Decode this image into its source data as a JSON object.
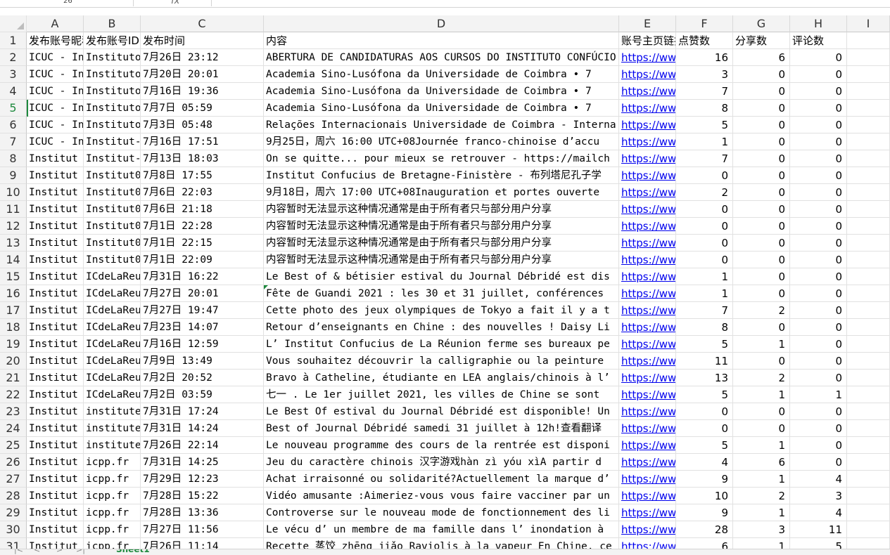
{
  "formula_bar": {
    "cell_ref": "26",
    "fx": "fx"
  },
  "columns": [
    "A",
    "B",
    "C",
    "D",
    "E",
    "F",
    "G",
    "H",
    "I"
  ],
  "sheet_tab": "Sheet1",
  "header_row": [
    "发布账号昵称",
    "发布账号ID",
    "发布时间",
    "内容",
    "账号主页链接",
    "点赞数",
    "分享数",
    "评论数",
    ""
  ],
  "rows": [
    [
      "ICUC - Instituto",
      "Instituto",
      "7月26日 23:12",
      "ABERTURA DE CANDIDATURAS AOS CURSOS DO INSTITUTO CONFÚCIO",
      "https://www",
      "16",
      "6",
      "0",
      ""
    ],
    [
      "ICUC - Instituto",
      "Instituto",
      "7月20日 20:01",
      "Academia Sino-Lusófona da Universidade de Coimbra  •  7",
      "https://www",
      "3",
      "0",
      "0",
      ""
    ],
    [
      "ICUC - Instituto",
      "Instituto",
      "7月16日 19:36",
      "Academia Sino-Lusófona da Universidade de Coimbra  •  7",
      "https://www",
      "7",
      "0",
      "0",
      ""
    ],
    [
      "ICUC - Instituto",
      "Instituto",
      "7月7日 05:59",
      "Academia Sino-Lusófona da Universidade de Coimbra  •  7",
      "https://www",
      "8",
      "0",
      "0",
      ""
    ],
    [
      "ICUC - Instituto",
      "Instituto",
      "7月3日 05:48",
      "Relações Internacionais Universidade de Coimbra - Interna",
      "https://www",
      "5",
      "0",
      "0",
      ""
    ],
    [
      "ICUC - Instituto",
      "Institut-",
      "7月16日 17:51",
      "9月25日，周六 16:00 UTC+08Journée franco-chinoise d’accu",
      "https://www",
      "1",
      "0",
      "0",
      ""
    ],
    [
      "Institut",
      "Institut-",
      "7月13日 18:03",
      "On se quitte... pour mieux se retrouver - https://mailch",
      "https://www",
      "7",
      "0",
      "0",
      ""
    ],
    [
      "Institut",
      "Institut0",
      "7月8日 17:55",
      "Institut Confucius de Bretagne-Finistère - 布列塔尼孔子学",
      "https://www",
      "0",
      "0",
      "0",
      ""
    ],
    [
      "Institut",
      "Institut0",
      "7月6日 22:03",
      "9月18日，周六 17:00 UTC+08Inauguration et portes ouverte",
      "https://www",
      "2",
      "0",
      "0",
      ""
    ],
    [
      "Institut",
      "Institut0",
      "7月6日 21:18",
      "内容暂时无法显示这种情况通常是由于所有者只与部分用户分享",
      "https://www",
      "0",
      "0",
      "0",
      ""
    ],
    [
      "Institut",
      "Institut0",
      "7月1日 22:28",
      "内容暂时无法显示这种情况通常是由于所有者只与部分用户分享",
      "https://www",
      "0",
      "0",
      "0",
      ""
    ],
    [
      "Institut",
      "Institut0",
      "7月1日 22:15",
      "内容暂时无法显示这种情况通常是由于所有者只与部分用户分享",
      "https://www",
      "0",
      "0",
      "0",
      ""
    ],
    [
      "Institut",
      "Institut0",
      "7月1日 22:09",
      "内容暂时无法显示这种情况通常是由于所有者只与部分用户分享",
      "https://www",
      "0",
      "0",
      "0",
      ""
    ],
    [
      "Institut",
      "ICdeLaReu",
      "7月31日 16:22",
      "Le Best of & bétisier estival du Journal Débridé est dis",
      "https://www",
      "1",
      "0",
      "0",
      ""
    ],
    [
      "Institut",
      "ICdeLaReu",
      "7月27日 20:01",
      "Fête de Guandi 2021 : les 30 et 31 juillet, conférences",
      "https://www",
      "1",
      "0",
      "0",
      ""
    ],
    [
      "Institut",
      "ICdeLaReu",
      "7月27日 19:47",
      "Cette photo des jeux olympiques de Tokyo a fait il y a t",
      "https://www",
      "7",
      "2",
      "0",
      ""
    ],
    [
      "Institut",
      "ICdeLaReu",
      "7月23日 14:07",
      "Retour d’enseignants en Chine : des nouvelles ! Daisy Li",
      "https://www",
      "8",
      "0",
      "0",
      ""
    ],
    [
      "Institut",
      "ICdeLaReu",
      "7月16日 12:59",
      "L’ Institut Confucius de La Réunion ferme ses bureaux pe",
      "https://www",
      "5",
      "1",
      "0",
      ""
    ],
    [
      "Institut",
      "ICdeLaReu",
      "7月9日 13:49",
      "Vous souhaitez découvrir la calligraphie ou la peinture",
      "https://www",
      "11",
      "0",
      "0",
      ""
    ],
    [
      "Institut",
      "ICdeLaReu",
      "7月2日 20:52",
      "Bravo à Catheline, étudiante en LEA anglais/chinois à l’",
      "https://www",
      "13",
      "2",
      "0",
      ""
    ],
    [
      "Institut",
      "ICdeLaReu",
      "7月2日 03:59",
      "七一 .  Le 1er juillet 2021, les villes de Chine se sont",
      "https://www",
      "5",
      "1",
      "1",
      ""
    ],
    [
      "Institut",
      "institute",
      "7月31日 17:24",
      "Le Best Of estival du Journal Débridé est disponible! Un",
      "https://www",
      "0",
      "0",
      "0",
      ""
    ],
    [
      "Institut",
      "institute",
      "7月31日 14:24",
      "Best of Journal Débridé samedi 31 juillet à 12h!查看翻译",
      "https://www",
      "0",
      "0",
      "0",
      ""
    ],
    [
      "Institut",
      "institute",
      "7月26日 22:14",
      "Le nouveau programme des cours de la rentrée est disponi",
      "https://www",
      "5",
      "1",
      "0",
      ""
    ],
    [
      "Institut",
      "icpp.fr",
      "7月31日 14:25",
      "Jeu du caractère chinois 汉字游戏hàn zì yóu xìA partir d",
      "https://www",
      "4",
      "6",
      "0",
      ""
    ],
    [
      "Institut",
      "icpp.fr",
      "7月29日 12:23",
      "Achat irraisonné ou solidarité?Actuellement la marque d’",
      "https://www",
      "9",
      "1",
      "4",
      ""
    ],
    [
      "Institut",
      "icpp.fr",
      "7月28日 15:22",
      "Vidéo amusante :Aimeriez-vous vous faire vacciner par un",
      "https://www",
      "10",
      "2",
      "3",
      ""
    ],
    [
      "Institut",
      "icpp.fr",
      "7月28日 13:36",
      "Controverse sur le nouveau mode de fonctionnement des li",
      "https://www",
      "9",
      "1",
      "4",
      ""
    ],
    [
      "Institut",
      "icpp.fr",
      "7月27日 11:56",
      "Le vécu d’ un membre de ma famille dans l’ inondation à",
      "https://www",
      "28",
      "3",
      "11",
      ""
    ],
    [
      "Institut",
      "icpp.fr",
      "7月26日 11:14",
      "Recette 蒸饺 zhēng jiǎo Raviolis à la vapeur En Chine, ce pl",
      "https://www",
      "6",
      "1",
      "5",
      ""
    ]
  ]
}
